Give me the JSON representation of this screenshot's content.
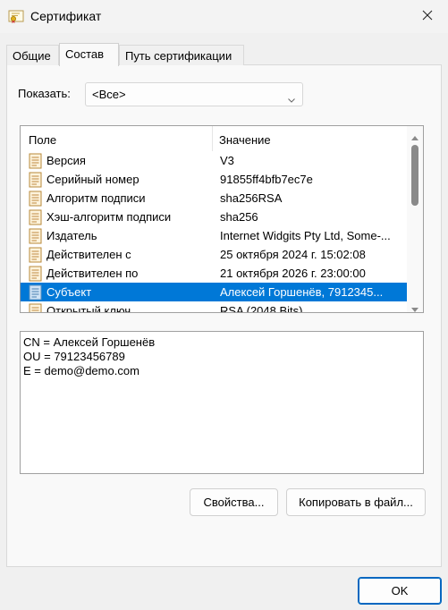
{
  "window": {
    "title": "Сертификат",
    "icon": "certificate-icon",
    "close_icon": "close-icon"
  },
  "tabs": [
    {
      "label": "Общие",
      "active": false
    },
    {
      "label": "Состав",
      "active": true
    },
    {
      "label": "Путь сертификации",
      "active": false
    }
  ],
  "show": {
    "label": "Показать:",
    "selected": "<Все>"
  },
  "list": {
    "columns": {
      "field": "Поле",
      "value": "Значение"
    },
    "rows": [
      {
        "field": "Версия",
        "value": "V3",
        "icon": "certificate-field-icon"
      },
      {
        "field": "Серийный номер",
        "value": "91855ff4bfb7ec7e",
        "icon": "certificate-field-icon"
      },
      {
        "field": "Алгоритм подписи",
        "value": "sha256RSA",
        "icon": "certificate-field-icon"
      },
      {
        "field": "Хэш-алгоритм подписи",
        "value": "sha256",
        "icon": "certificate-field-icon"
      },
      {
        "field": "Издатель",
        "value": "Internet Widgits Pty Ltd, Some-...",
        "icon": "certificate-field-icon"
      },
      {
        "field": "Действителен с",
        "value": "25 октября 2024 г. 15:02:08",
        "icon": "certificate-field-icon"
      },
      {
        "field": "Действителен по",
        "value": "21 октября 2026 г. 23:00:00",
        "icon": "certificate-field-icon"
      },
      {
        "field": "Субъект",
        "value": "Алексей Горшенёв, 7912345...",
        "icon": "certificate-field-icon",
        "selected": true
      },
      {
        "field": "Открытый ключ",
        "value": "RSA (2048 Bits)",
        "icon": "certificate-field-icon"
      }
    ]
  },
  "details": {
    "lines": [
      "CN = Алексей Горшенёв",
      "OU = 79123456789",
      "E = demo@demo.com"
    ]
  },
  "buttons": {
    "properties": "Свойства...",
    "copy_to_file": "Копировать в файл...",
    "ok": "OK"
  },
  "colors": {
    "selection": "#0078d7",
    "accent_border": "#0067c0"
  }
}
